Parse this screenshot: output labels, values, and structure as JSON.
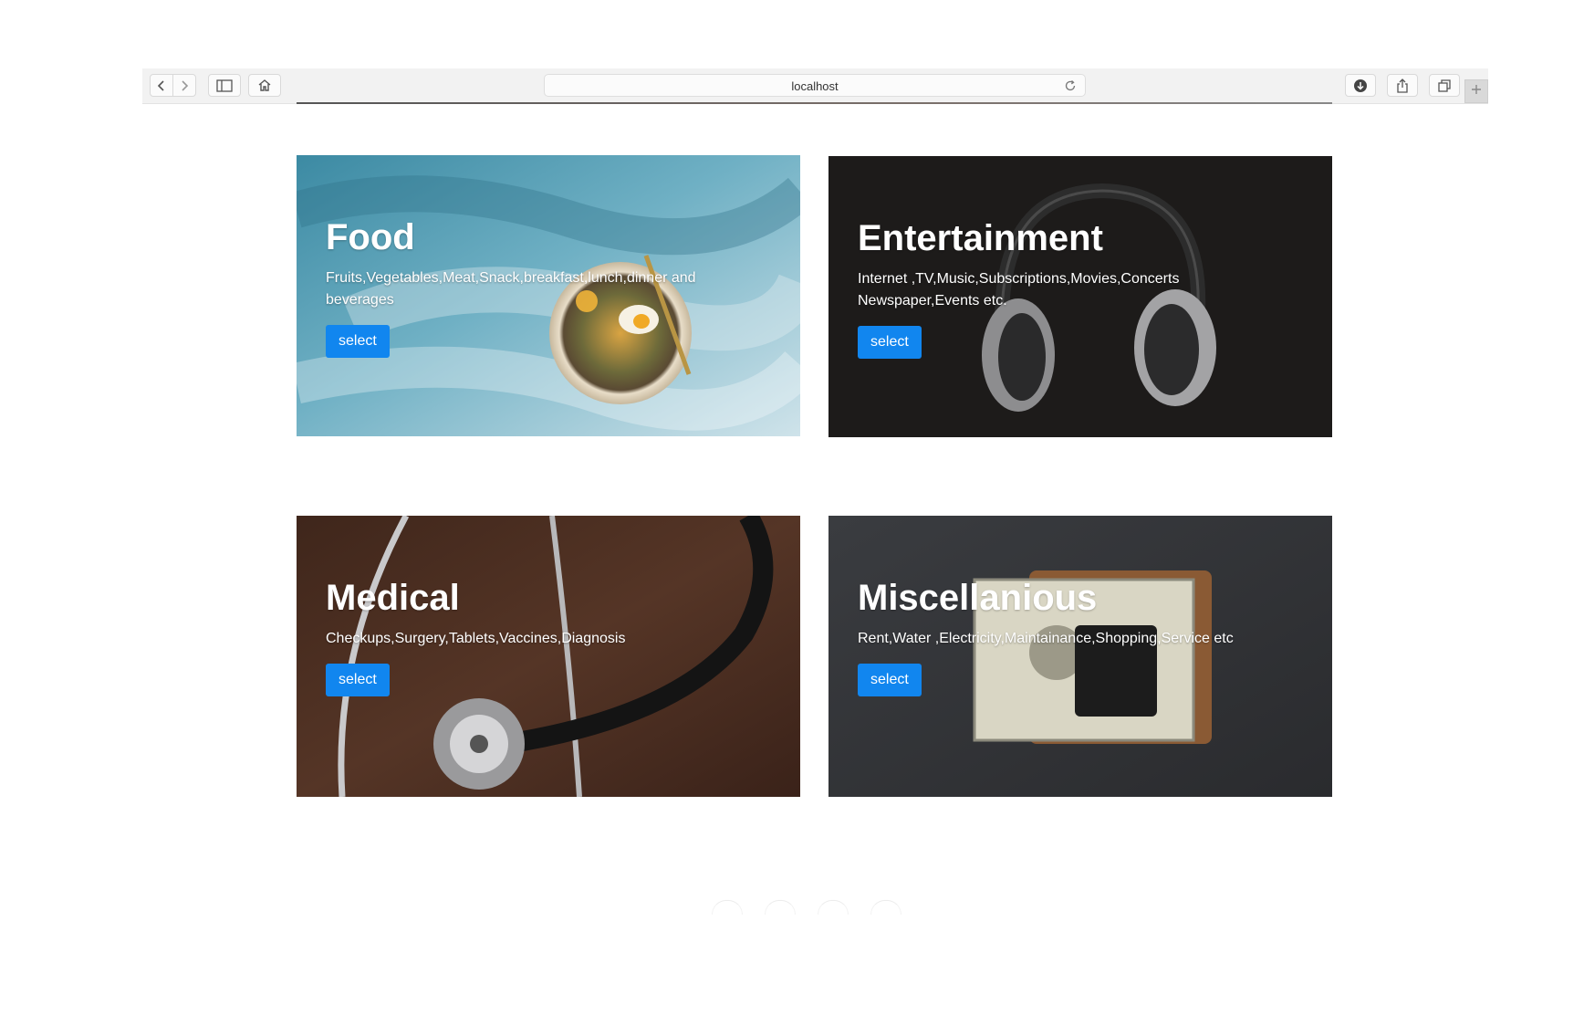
{
  "browser": {
    "address": "localhost"
  },
  "cards": [
    {
      "title": "Food",
      "description": "Fruits,Vegetables,Meat,Snack,breakfast,lunch,dinner and beverages",
      "button": "select"
    },
    {
      "title": "Entertainment",
      "description": "Internet ,TV,Music,Subscriptions,Movies,Concerts Newspaper,Events etc.",
      "button": "select"
    },
    {
      "title": "Medical",
      "description": "Checkups,Surgery,Tablets,Vaccines,Diagnosis",
      "button": "select"
    },
    {
      "title": "Miscellanious",
      "description": "Rent,Water ,Electricity,Maintainance,Shopping,Service etc",
      "button": "select"
    }
  ],
  "icons": {
    "back": "chevron-left-icon",
    "forward": "chevron-right-icon",
    "sidebar": "sidebar-icon",
    "home": "home-icon",
    "reload": "reload-icon",
    "download": "download-icon",
    "share": "share-icon",
    "tabs": "tabs-icon",
    "new_tab": "plus-icon"
  },
  "colors": {
    "button": "#1186ef",
    "card_text": "#ffffff"
  }
}
